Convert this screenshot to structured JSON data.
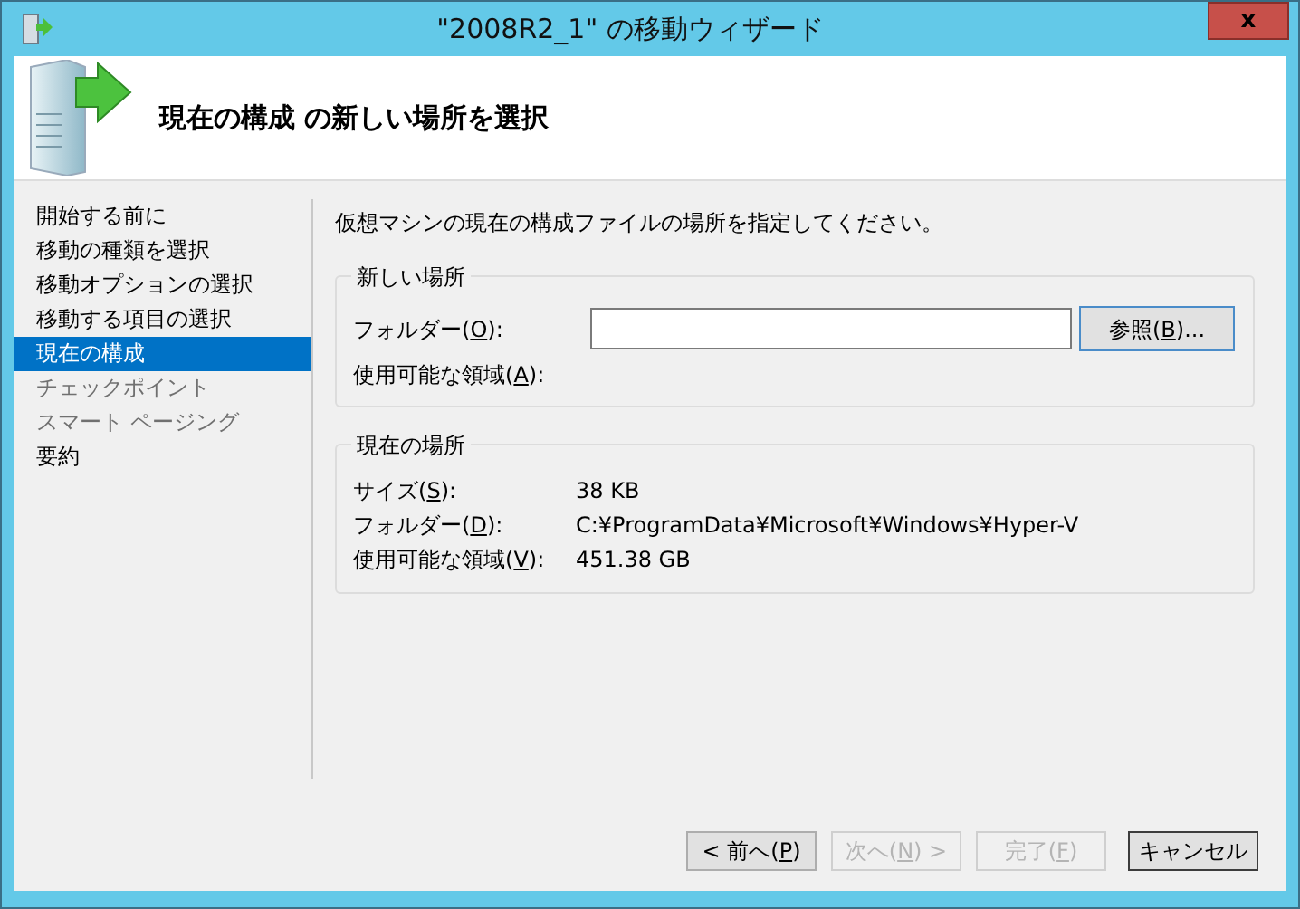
{
  "window": {
    "title": "\"2008R2_1\" の移動ウィザード",
    "close": "x"
  },
  "header": {
    "title": "現在の構成 の新しい場所を選択"
  },
  "steps": [
    {
      "label": "開始する前に",
      "selected": false,
      "disabled": false
    },
    {
      "label": "移動の種類を選択",
      "selected": false,
      "disabled": false
    },
    {
      "label": "移動オプションの選択",
      "selected": false,
      "disabled": false
    },
    {
      "label": "移動する項目の選択",
      "selected": false,
      "disabled": false
    },
    {
      "label": "現在の構成",
      "selected": true,
      "disabled": false
    },
    {
      "label": "チェックポイント",
      "selected": false,
      "disabled": true
    },
    {
      "label": "スマート ページング",
      "selected": false,
      "disabled": true
    },
    {
      "label": "要約",
      "selected": false,
      "disabled": false
    }
  ],
  "instruction": "仮想マシンの現在の構成ファイルの場所を指定してください。",
  "new_location": {
    "title": "新しい場所",
    "folder_label": [
      "フォルダー(",
      "O",
      "):"
    ],
    "browse_button": [
      "参照(",
      "B",
      ")..."
    ],
    "space_label": [
      "使用可能な領域(",
      "A",
      "):"
    ]
  },
  "current_location": {
    "title": "現在の場所",
    "rows": [
      {
        "label": [
          "サイズ(",
          "S",
          "):"
        ],
        "value": "38 KB"
      },
      {
        "label": [
          "フォルダー(",
          "D",
          "):"
        ],
        "value": "C:¥ProgramData¥Microsoft¥Windows¥Hyper-V"
      },
      {
        "label": [
          "使用可能な領域(",
          "V",
          "):"
        ],
        "value": "451.38 GB"
      }
    ]
  },
  "buttons": [
    {
      "label": [
        "< 前へ(",
        "P",
        ")"
      ],
      "disabled": false,
      "default": false
    },
    {
      "label": [
        "次へ(",
        "N",
        ") >"
      ],
      "disabled": true,
      "default": false
    },
    {
      "label": [
        "完了(",
        "F",
        ")"
      ],
      "disabled": true,
      "default": false
    },
    {
      "label": [
        "キャンセル"
      ],
      "disabled": false,
      "default": true
    }
  ]
}
